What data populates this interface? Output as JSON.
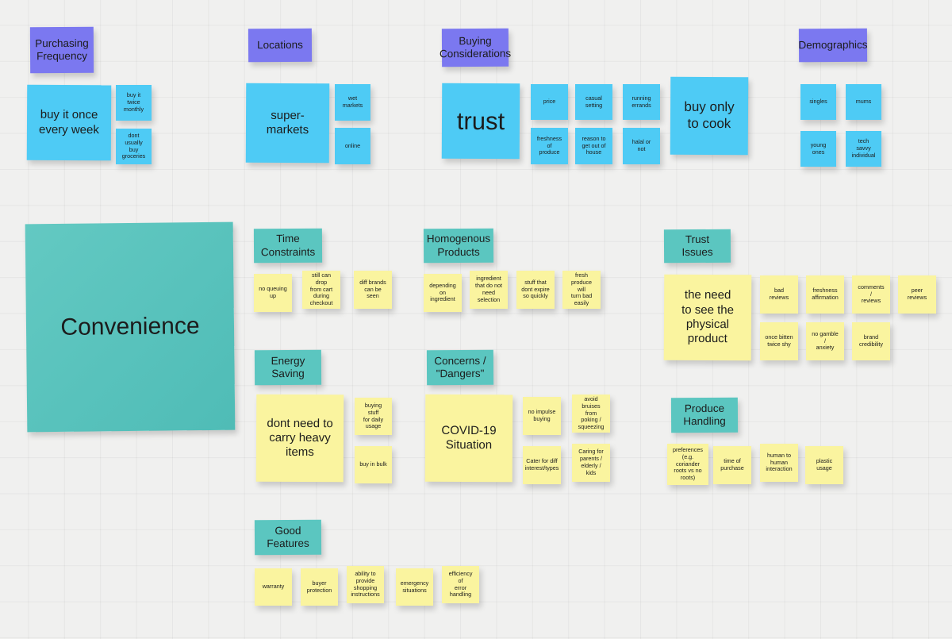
{
  "board": {
    "background_color": "#f0f0ef",
    "grid": "on",
    "colors": {
      "blue": "#4ecbf5",
      "purple": "#7b78f0",
      "teal": "#5bc6c0",
      "yellow": "#faf49f",
      "text": "#1c1c1c"
    }
  },
  "top_sections": [
    {
      "header": "Purchasing\nFrequency",
      "primary": "buy it once\nevery week",
      "notes": [
        "buy it twice\nmonthly",
        "dont usually\nbuy groceries"
      ]
    },
    {
      "header": "Locations",
      "primary": "super-\nmarkets",
      "notes": [
        "wet\nmarkets",
        "online"
      ]
    },
    {
      "header": "Buying\nConsiderations",
      "primary": "trust",
      "notes": [
        "price",
        "casual\nsetting",
        "running\nerrands",
        "freshness\nof\nproduce",
        "reason to\nget out of\nhouse",
        "halal or\nnot"
      ]
    },
    {
      "header": "Demographics",
      "primary": "buy only\nto cook",
      "notes": [
        "singles",
        "mums",
        "young\nones",
        "tech savvy\nindividual"
      ]
    }
  ],
  "main_theme": {
    "label": "Convenience"
  },
  "clusters": [
    {
      "header": "Time\nConstraints",
      "notes": [
        "no queuing\nup",
        "still can drop\nfrom cart\nduring\ncheckout",
        "diff brands\ncan be seen"
      ]
    },
    {
      "header": "Homogenous\nProducts",
      "notes": [
        "depending\non ingredient",
        "ingredient\nthat do not\nneed\nselection",
        "stuff that\ndont expire\nso quickly",
        "fresh\nproduce will\nturn bad\neasily"
      ]
    },
    {
      "header": "Trust Issues",
      "primary": "the need\nto see the\nphysical\nproduct",
      "notes": [
        "bad reviews",
        "freshness\naffirmation",
        "comments /\nreviews",
        "peer reviews",
        "once bitten\ntwice shy",
        "no gamble /\nanxiety",
        "brand\ncredibility"
      ]
    },
    {
      "header": "Energy\nSaving",
      "primary": "dont need to\ncarry heavy\nitems",
      "notes": [
        "buying stuff\nfor daily\nusage",
        "buy in bulk"
      ]
    },
    {
      "header": "Concerns /\n\"Dangers\"",
      "primary": "COVID-19\nSituation",
      "notes": [
        "no impulse\nbuying",
        "avoid bruises\nfrom poking /\nsqueezing",
        "Cater for diff\ninterest/types",
        "Caring for\nparents /\nelderly / kids"
      ]
    },
    {
      "header": "Produce\nHandling",
      "notes": [
        "preferences\n(e.g. coriander\nroots vs no\nroots)",
        "time of\npurchase",
        "human to\nhuman\ninteraction",
        "plastic usage"
      ]
    },
    {
      "header": "Good\nFeatures",
      "notes": [
        "warranty",
        "buyer\nprotection",
        "ability to\nprovide\nshopping\ninstructions",
        "emergency\nsituations",
        "efficiency of\nerror\nhandling"
      ]
    }
  ]
}
